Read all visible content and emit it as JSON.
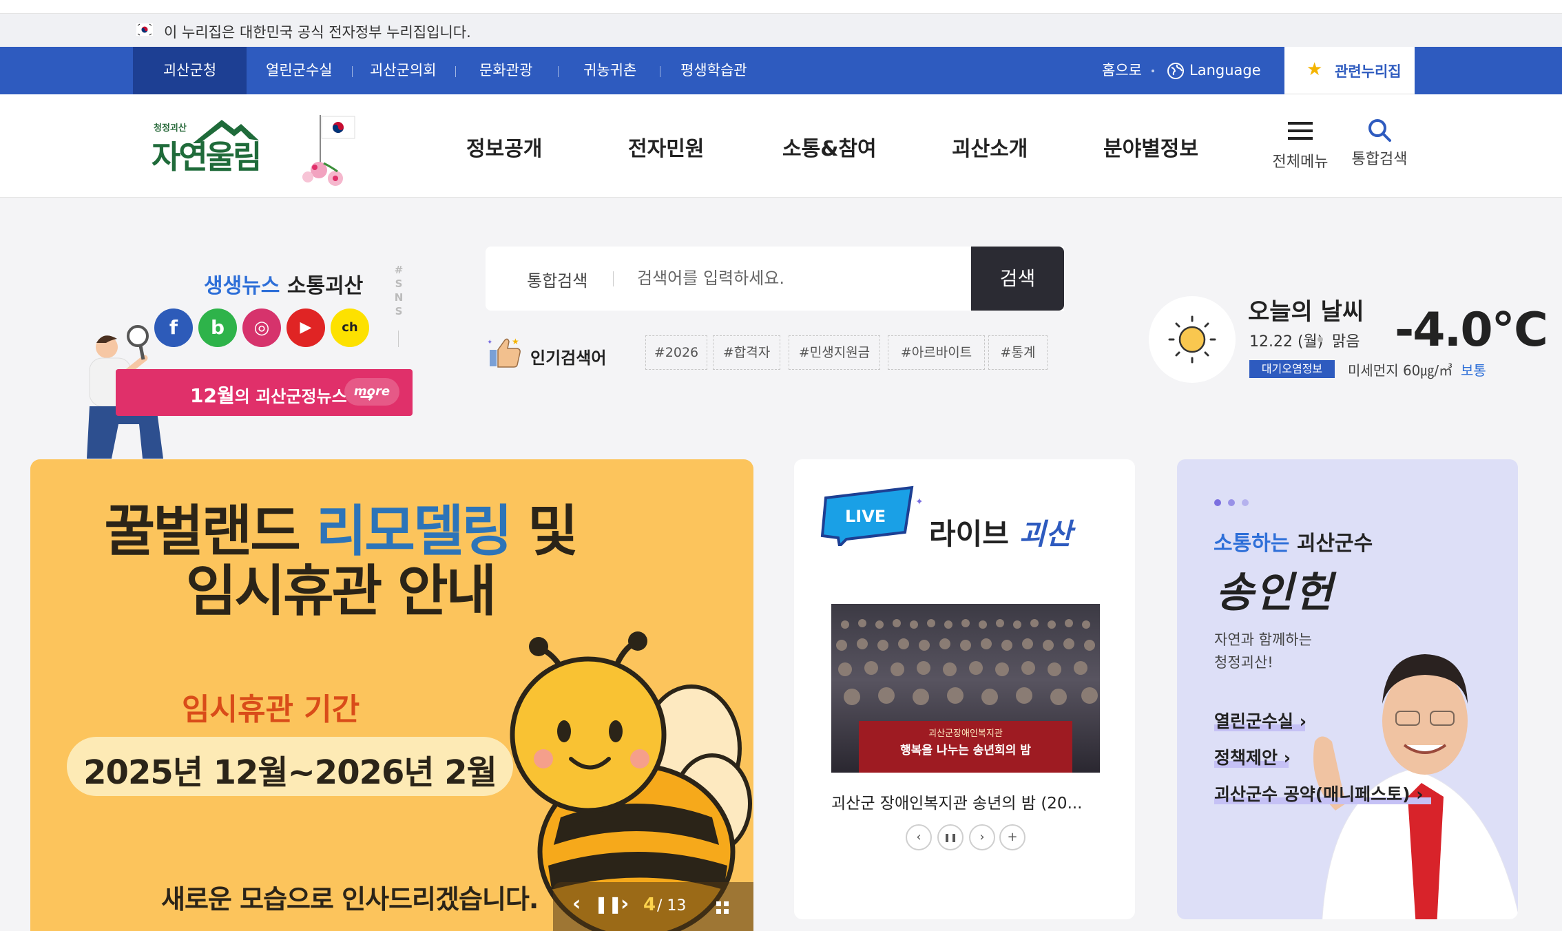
{
  "gov_banner": {
    "text": "이 누리집은 대한민국 공식 전자정부 누리집입니다."
  },
  "util_nav": {
    "items": [
      "괴산군청",
      "열린군수실",
      "괴산군의회",
      "문화관광",
      "귀농귀촌",
      "평생학습관"
    ],
    "home": "홈으로",
    "language": "Language",
    "related": "관련누리집"
  },
  "header": {
    "logo_small": "청정괴산",
    "logo_big": "자연울림",
    "gnb": [
      "정보공개",
      "전자민원",
      "소통&참여",
      "괴산소개",
      "분야별정보"
    ],
    "all_menu": "전체메뉴",
    "search": "통합검색"
  },
  "sns": {
    "title_blue": "생생뉴스",
    "title_rest": "소통괴산",
    "vertical": "SNS",
    "icons": [
      {
        "name": "facebook-icon",
        "glyph": "f",
        "color": "#2d5bb9"
      },
      {
        "name": "blog-icon",
        "glyph": "b",
        "color": "#2eb34a"
      },
      {
        "name": "instagram-icon",
        "glyph": "◎",
        "color": "#d6336c"
      },
      {
        "name": "youtube-icon",
        "glyph": "▶",
        "color": "#e02424"
      },
      {
        "name": "kakao-channel-icon",
        "glyph": "ch",
        "color": "#fde100"
      }
    ],
    "news_month": "12월",
    "news_rest": "의 괴산군정뉴스",
    "news_arrow": "→",
    "more": "more"
  },
  "search": {
    "scope": "통합검색",
    "placeholder": "검색어를 입력하세요.",
    "button": "검색",
    "popular_label": "인기검색어",
    "tags": [
      "#2026",
      "#합격자",
      "#민생지원금",
      "#아르바이트",
      "#통계"
    ]
  },
  "weather": {
    "title": "오늘의 날씨",
    "date": "12.22 (월)",
    "condition": "맑음",
    "temperature": "-4.0℃",
    "badge": "대기오염정보",
    "dust": "미세먼지 60㎍/㎥",
    "dust_status": "보통"
  },
  "banner": {
    "line1_a": "꿀벌랜드 ",
    "line1_b": "리모델링",
    "line1_c": " 및",
    "line2": "임시휴관 안내",
    "sub": "임시휴관 기간",
    "period": "2025년 12월~2026년 2월",
    "footer": "새로운 모습으로 인사드리겠습니다.",
    "current": "4",
    "total": "/ 13"
  },
  "live": {
    "badge": "LIVE",
    "title_a": "라이브 ",
    "title_b": "괴산",
    "photo_banner_top": "괴산군장애인복지관",
    "photo_banner_main": "행복을 나누는 송년회의 밤",
    "caption": "괴산군 장애인복지관 송년의 밤 (20..."
  },
  "mayor": {
    "title_blue": "소통하는",
    "title_rest": " 괴산군수",
    "name": "송인헌",
    "desc1": "자연과 함께하는",
    "desc2": "청정괴산!",
    "links": [
      "열린군수실",
      "정책제안",
      "괴산군수 공약(매니페스토)"
    ]
  },
  "colors": {
    "primary": "#2e5bbf",
    "dark_nav": "#1d3f93",
    "banner_bg": "#fcc45c",
    "news_pink": "#e0306a"
  }
}
